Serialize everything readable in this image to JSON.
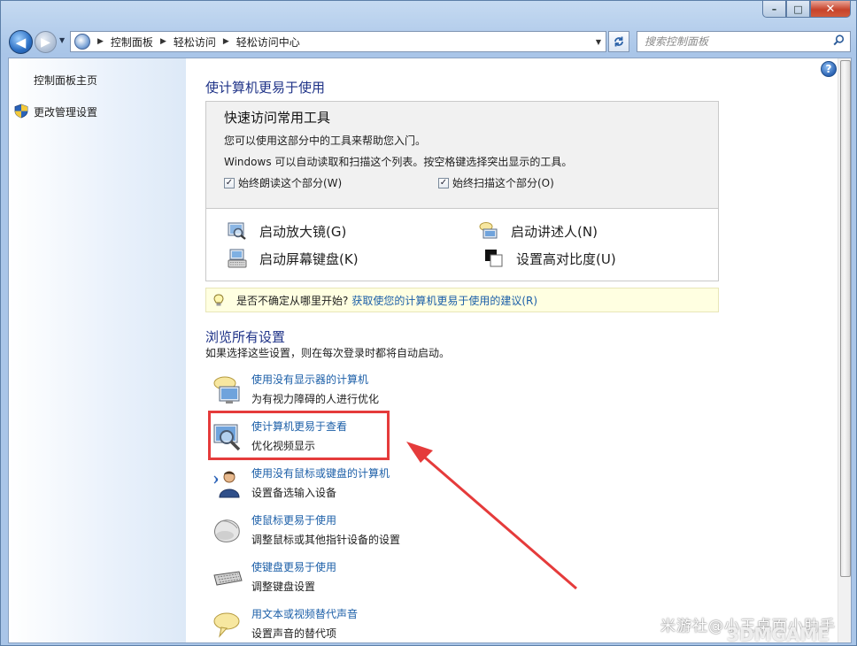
{
  "window": {
    "caption_buttons": {
      "minimize": "–",
      "maximize": "□",
      "close": "✕"
    }
  },
  "address_bar": {
    "crumbs": [
      "控制面板",
      "轻松访问",
      "轻松访问中心"
    ],
    "search_placeholder": "搜索控制面板"
  },
  "sidebar": {
    "items": [
      {
        "label": "控制面板主页"
      },
      {
        "label": "更改管理设置"
      }
    ]
  },
  "main": {
    "heading": "使计算机更易于使用",
    "quick_access": {
      "title": "快速访问常用工具",
      "desc1": "您可以使用这部分中的工具来帮助您入门。",
      "desc2": "Windows 可以自动读取和扫描这个列表。按空格键选择突出显示的工具。",
      "check_read": "始终朗读这个部分(W)",
      "check_scan": "始终扫描这个部分(O)",
      "tools": {
        "magnifier": "启动放大镜(G)",
        "narrator": "启动讲述人(N)",
        "osk": "启动屏幕键盘(K)",
        "contrast": "设置高对比度(U)"
      }
    },
    "tip": {
      "text": "是否不确定从哪里开始?",
      "link": "获取使您的计算机更易于使用的建议(R)"
    },
    "browse": {
      "heading": "浏览所有设置",
      "subtitle": "如果选择这些设置，则在每次登录时都将自动启动。",
      "items": [
        {
          "title": "使用没有显示器的计算机",
          "desc": "为有视力障碍的人进行优化",
          "icon": "screen-speech-icon"
        },
        {
          "title": "使计算机更易于查看",
          "desc": "优化视频显示",
          "icon": "monitor-magnifier-icon"
        },
        {
          "title": "使用没有鼠标或键盘的计算机",
          "desc": "设置备选输入设备",
          "icon": "person-speaking-icon"
        },
        {
          "title": "使鼠标更易于使用",
          "desc": "调整鼠标或其他指针设备的设置",
          "icon": "mouse-icon"
        },
        {
          "title": "使键盘更易于使用",
          "desc": "调整键盘设置",
          "icon": "keyboard-icon"
        },
        {
          "title": "用文本或视频替代声音",
          "desc": "设置声音的替代项",
          "icon": "speech-bubble-icon"
        }
      ]
    }
  },
  "overlay": {
    "watermark": "米游社@小王桌面小助手",
    "logo": "3DMGAME",
    "annotation_color": "#e53b3b"
  }
}
